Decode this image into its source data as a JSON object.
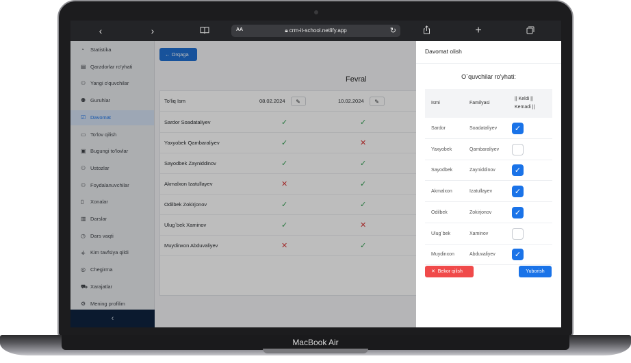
{
  "device": {
    "label": "MacBook Air"
  },
  "browser": {
    "text_size_label": "AA",
    "url": "crm-it-school.netlify.app"
  },
  "sidebar": {
    "items": [
      {
        "label": "Statistika",
        "icon": "pie-chart-icon",
        "glyph": "◔"
      },
      {
        "label": "Qarzdorlar ro'yhati",
        "icon": "ledger-icon",
        "glyph": "▤"
      },
      {
        "label": "Yangi o'quvchilar",
        "icon": "user-icon",
        "glyph": "⚇"
      },
      {
        "label": "Guruhlar",
        "icon": "group-icon",
        "glyph": "⚉"
      },
      {
        "label": "Davomat",
        "icon": "attendance-icon",
        "glyph": "☑"
      },
      {
        "label": "To'lov qilish",
        "icon": "payment-icon",
        "glyph": "▭"
      },
      {
        "label": "Bugungi to'lovlar",
        "icon": "wallet-icon",
        "glyph": "▣"
      },
      {
        "label": "Ustozlar",
        "icon": "teacher-icon",
        "glyph": "⚇"
      },
      {
        "label": "Foydalanuvchilar",
        "icon": "users-icon",
        "glyph": "⚇"
      },
      {
        "label": "Xonalar",
        "icon": "door-icon",
        "glyph": "▯"
      },
      {
        "label": "Darslar",
        "icon": "book-icon",
        "glyph": "▥"
      },
      {
        "label": "Dars vaqti",
        "icon": "clock-icon",
        "glyph": "◷"
      },
      {
        "label": "Kim tavfsiya qildi",
        "icon": "network-icon",
        "glyph": "⚶"
      },
      {
        "label": "Chegirma",
        "icon": "discount-icon",
        "glyph": "◎"
      },
      {
        "label": "Xarajatlar",
        "icon": "cart-icon",
        "glyph": "⛟"
      },
      {
        "label": "Mening profilim",
        "icon": "gear-icon",
        "glyph": "⚙"
      }
    ],
    "active_index": 4,
    "collapse_glyph": "‹"
  },
  "main": {
    "back_label": "Orqaga",
    "month": "Fevral",
    "table": {
      "name_header": "To'liq Ism",
      "dates": [
        "08.02.2024",
        "10.02.2024"
      ],
      "rows": [
        {
          "name": "Sardor Soadataliyev",
          "marks": [
            "✓",
            "✓"
          ]
        },
        {
          "name": "Yaxyobek Qambaraliyev",
          "marks": [
            "✓",
            "✕"
          ]
        },
        {
          "name": "Sayodbek Zayniddinov",
          "marks": [
            "✓",
            "✓"
          ]
        },
        {
          "name": "Akmalxon Izatullayev",
          "marks": [
            "✕",
            "✓"
          ]
        },
        {
          "name": "Odilbek Zokirjonov",
          "marks": [
            "✓",
            "✓"
          ]
        },
        {
          "name": "Ulug`bek Xaminov",
          "marks": [
            "✓",
            "✕"
          ]
        },
        {
          "name": "Muydinxon Abduvaliyev",
          "marks": [
            "✕",
            "✓"
          ]
        }
      ]
    }
  },
  "panel": {
    "title": "Davomat olish",
    "subtitle": "O`quvchilar ro'yhati:",
    "headers": {
      "first": "Ismi",
      "last": "Familyasi",
      "status_line1": "|| Keldi ||",
      "status_line2": "Kemadi ||"
    },
    "students": [
      {
        "first": "Sardor",
        "last": "Soadataliyev",
        "present": true
      },
      {
        "first": "Yaxyobek",
        "last": "Qambaraliyev",
        "present": false
      },
      {
        "first": "Sayodbek",
        "last": "Zayniddinov",
        "present": true
      },
      {
        "first": "Akmalxon",
        "last": "Izatullayev",
        "present": true
      },
      {
        "first": "Odilbek",
        "last": "Zokirjonov",
        "present": true
      },
      {
        "first": "Ulug`bek",
        "last": "Xaminov",
        "present": false
      },
      {
        "first": "Muydinxon",
        "last": "Abduvaliyev",
        "present": true
      }
    ],
    "cancel_label": "Bekor qilish",
    "send_label": "Yuborish"
  },
  "colors": {
    "accent": "#1a73e8",
    "danger": "#f04a4a",
    "success": "#2e9e4f"
  }
}
